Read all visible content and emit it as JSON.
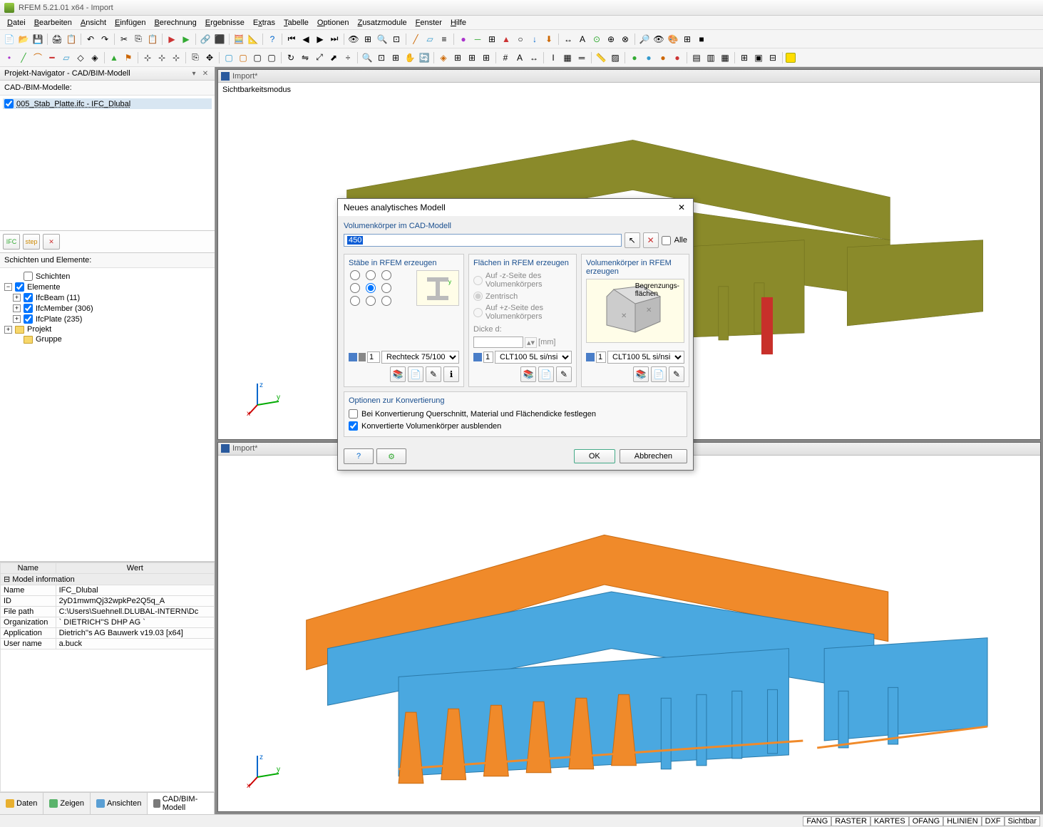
{
  "window_title": "RFEM 5.21.01 x64 - Import",
  "menu": [
    "Datei",
    "Bearbeiten",
    "Ansicht",
    "Einfügen",
    "Berechnung",
    "Ergebnisse",
    "Extras",
    "Tabelle",
    "Optionen",
    "Zusatzmodule",
    "Fenster",
    "Hilfe"
  ],
  "navigator": {
    "title": "Projekt-Navigator - CAD/BIM-Modell",
    "models_label": "CAD-/BIM-Modelle:",
    "model_item": "005_Stab_Platte.ifc - IFC_Dlubal",
    "layers_label": "Schichten und Elemente:",
    "tree": {
      "schichten": "Schichten",
      "elemente": "Elemente",
      "ifcbeam": "IfcBeam (11)",
      "ifcmember": "IfcMember (306)",
      "ifcplate": "IfcPlate (235)",
      "projekt": "Projekt",
      "gruppe": "Gruppe"
    },
    "prop_header_name": "Name",
    "prop_header_value": "Wert",
    "prop_group": "Model information",
    "props": [
      {
        "n": "Name",
        "v": "IFC_Dlubal"
      },
      {
        "n": "ID",
        "v": "2yD1mwmQj32wpkPe2Q5q_A"
      },
      {
        "n": "File path",
        "v": "C:\\Users\\Suehnell.DLUBAL-INTERN\\Dc"
      },
      {
        "n": "Organization",
        "v": "`   DIETRICH''S DHP  AG   `"
      },
      {
        "n": "Application",
        "v": "Dietrich''s AG Bauwerk v19.03 [x64]"
      },
      {
        "n": "User name",
        "v": "a.buck"
      }
    ],
    "tabs": [
      "Daten",
      "Zeigen",
      "Ansichten",
      "CAD/BIM-Modell"
    ]
  },
  "viewport": {
    "tab_label": "Import*",
    "mode": "Sichtbarkeitsmodus"
  },
  "dialog": {
    "title": "Neues analytisches Modell",
    "vol_label": "Volumenkörper im CAD-Modell",
    "vol_value": "450",
    "all_label": "Alle",
    "col1_title": "Stäbe in RFEM erzeugen",
    "col2_title": "Flächen in RFEM erzeugen",
    "col3_title": "Volumenkörper in RFEM erzeugen",
    "face_opt1": "Auf -z-Seite des Volumenkörpers",
    "face_opt2": "Zentrisch",
    "face_opt3": "Auf +z-Seite des Volumenkörpers",
    "thickness_label": "Dicke d:",
    "thickness_unit": "[mm]",
    "beam_section_num": "1",
    "beam_section": "Rechteck 75/100",
    "face_mat_num": "1",
    "face_mat": "CLT100 5L si/nsi",
    "solid_mat_num": "1",
    "solid_mat": "CLT100 5L si/nsi",
    "solid_label1": "Begrenzungs-",
    "solid_label2": "flächen",
    "options_title": "Optionen zur Konvertierung",
    "opt1": "Bei Konvertierung Querschnitt, Material und Flächendicke festlegen",
    "opt2": "Konvertierte Volumenkörper ausblenden",
    "ok": "OK",
    "cancel": "Abbrechen"
  },
  "statusbar": [
    "FANG",
    "RASTER",
    "KARTES",
    "OFANG",
    "HLINIEN",
    "DXF",
    "Sichtbar"
  ]
}
